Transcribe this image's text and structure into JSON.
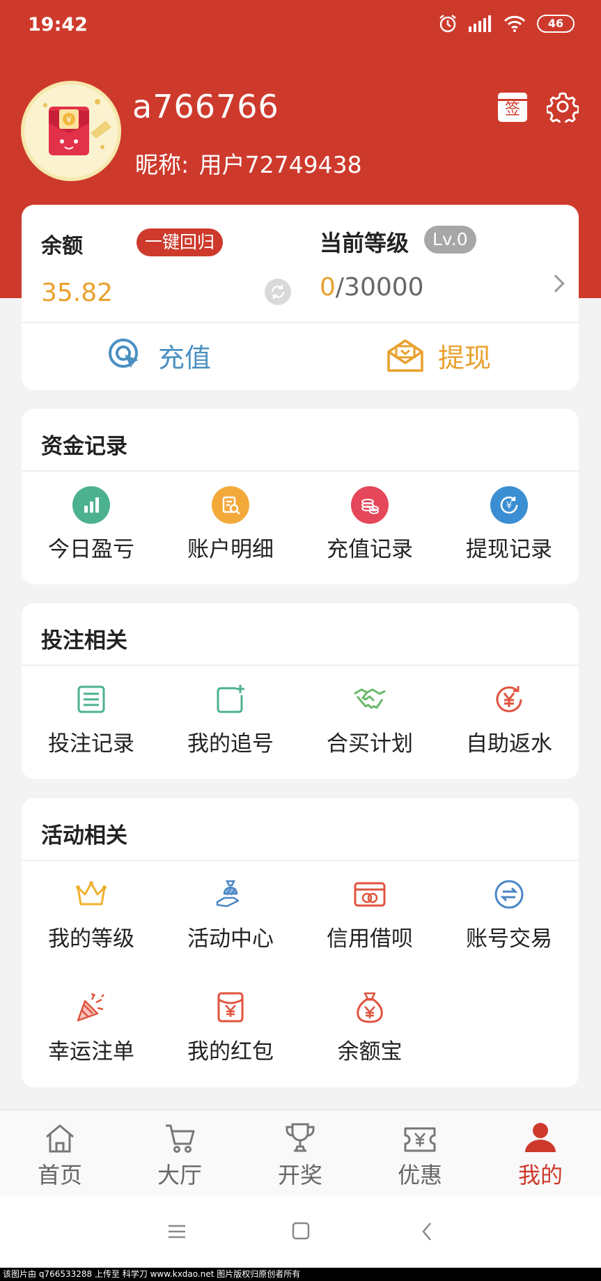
{
  "status": {
    "time": "19:42",
    "battery": "46"
  },
  "profile": {
    "username": "a766766",
    "nickname_label": "昵称:",
    "nickname_value": "用户72749438",
    "checkin_label": "签"
  },
  "account": {
    "balance_label": "余额",
    "return_button": "一键回归",
    "balance_value": "35.82",
    "level_label": "当前等级",
    "level_badge": "Lv.0",
    "level_current": "0",
    "level_total": "/30000",
    "recharge_label": "充值",
    "withdraw_label": "提现"
  },
  "funds": {
    "title": "资金记录",
    "items": [
      {
        "label": "今日盈亏",
        "icon": "bar-chart-icon",
        "color": "#4cb18f"
      },
      {
        "label": "账户明细",
        "icon": "detail-search-icon",
        "color": "#f3a93a"
      },
      {
        "label": "充值记录",
        "icon": "coins-icon",
        "color": "#e5475a"
      },
      {
        "label": "提现记录",
        "icon": "yen-arrow-icon",
        "color": "#3a8ed1"
      }
    ]
  },
  "bets": {
    "title": "投注相关",
    "items": [
      {
        "label": "投注记录",
        "icon": "list-icon",
        "color": "#4cb18f"
      },
      {
        "label": "我的追号",
        "icon": "add-square-icon",
        "color": "#4cb18f"
      },
      {
        "label": "合买计划",
        "icon": "handshake-icon",
        "color": "#6ab96a"
      },
      {
        "label": "自助返水",
        "icon": "yen-refresh-icon",
        "color": "#e0533e"
      }
    ]
  },
  "events": {
    "title": "活动相关",
    "items": [
      {
        "label": "我的等级",
        "icon": "crown-icon",
        "color": "#f0b030"
      },
      {
        "label": "活动中心",
        "icon": "gift-hand-icon",
        "color": "#4a86c5"
      },
      {
        "label": "信用借呗",
        "icon": "credit-card-icon",
        "color": "#e0533e"
      },
      {
        "label": "账号交易",
        "icon": "exchange-icon",
        "color": "#4a86c5"
      },
      {
        "label": "幸运注单",
        "icon": "party-popper-icon",
        "color": "#e0533e"
      },
      {
        "label": "我的红包",
        "icon": "red-envelope-icon",
        "color": "#e0533e"
      },
      {
        "label": "余额宝",
        "icon": "money-bag-icon",
        "color": "#e0533e"
      }
    ]
  },
  "tabs": [
    {
      "label": "首页",
      "icon": "home-icon"
    },
    {
      "label": "大厅",
      "icon": "cart-icon"
    },
    {
      "label": "开奖",
      "icon": "trophy-icon"
    },
    {
      "label": "优惠",
      "icon": "coupon-icon"
    },
    {
      "label": "我的",
      "icon": "user-icon",
      "active": true
    }
  ],
  "colors": {
    "brand": "#cd3a2c",
    "gold": "#e9a02c",
    "blue": "#4b90c1"
  },
  "watermark": "该图片由 q766533288 上传至 科学刀 www.kxdao.net 图片版权归原创者所有"
}
